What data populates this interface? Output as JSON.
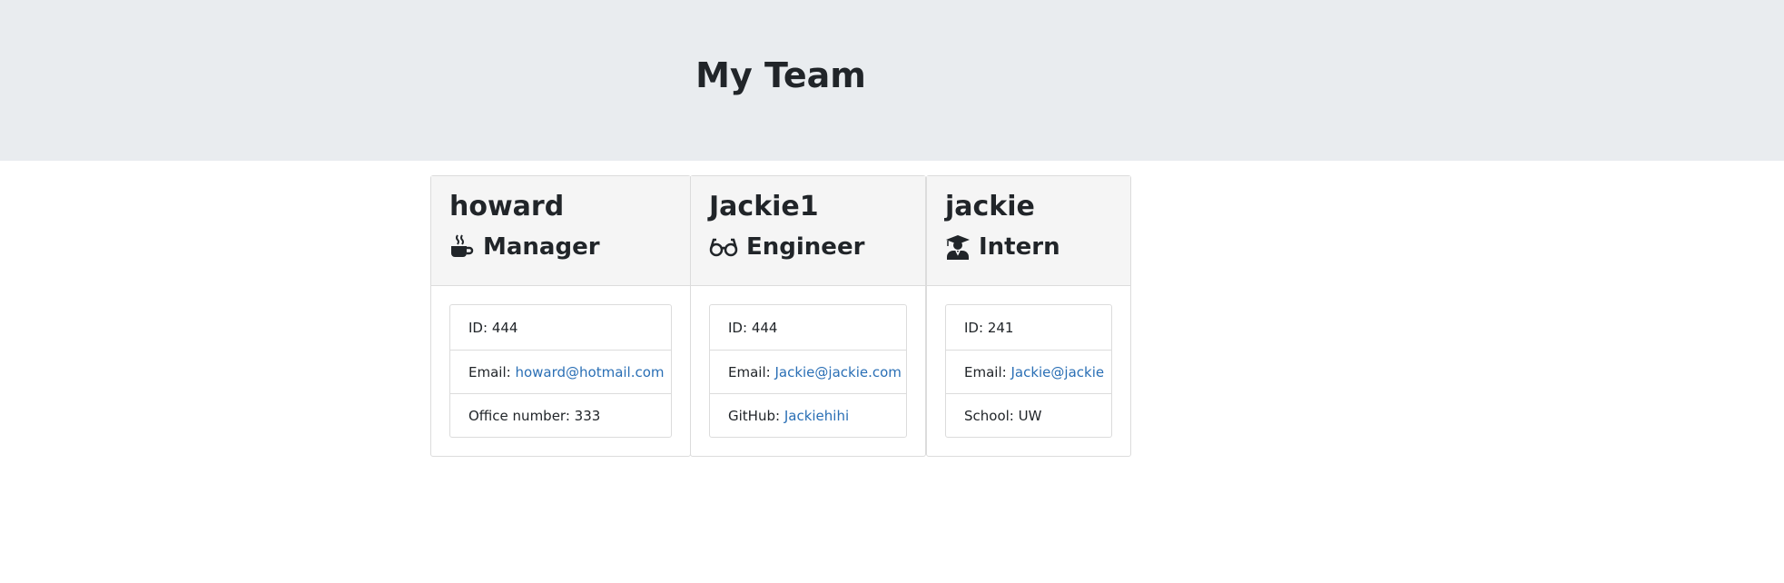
{
  "header": {
    "title": "My Team"
  },
  "employees": [
    {
      "name": "howard",
      "role": "Manager",
      "icon": "coffee-icon",
      "id_label": "ID: ",
      "id": "444",
      "email_label": "Email: ",
      "email": "howard@hotmail.com",
      "extra_label": "Office number: ",
      "extra": "333"
    },
    {
      "name": "Jackie1",
      "role": "Engineer",
      "icon": "glasses-icon",
      "id_label": "ID: ",
      "id": "444",
      "email_label": "Email: ",
      "email": "Jackie@jackie.com",
      "extra_label": "GitHub: ",
      "extra": "Jackiehihi"
    },
    {
      "name": "jackie",
      "role": "Intern",
      "icon": "graduate-icon",
      "id_label": "ID: ",
      "id": "241",
      "email_label": "Email: ",
      "email": "Jackie@jackie",
      "extra_label": "School: ",
      "extra": "UW"
    }
  ],
  "colors": {
    "header_background": "#e9ecef",
    "card_header_background": "#f5f5f5",
    "link": "#2a6fb5",
    "text": "#212529"
  }
}
